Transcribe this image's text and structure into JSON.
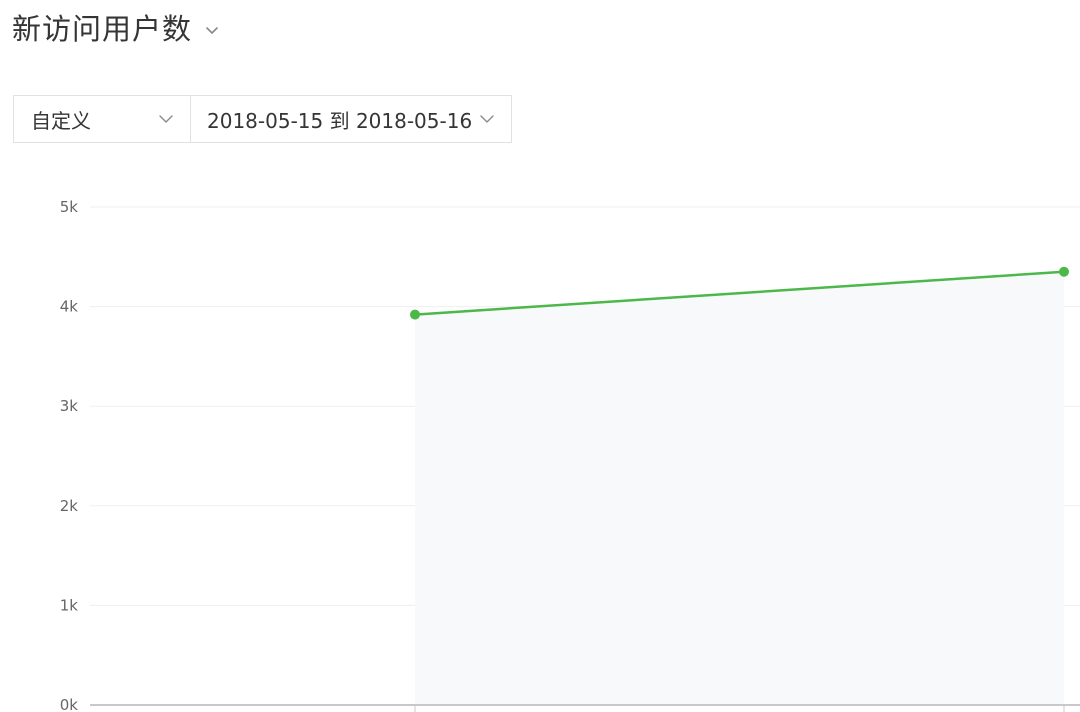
{
  "header": {
    "title": "新访问用户数"
  },
  "controls": {
    "range_type": "自定义",
    "date_range": "2018-05-15 到 2018-05-16"
  },
  "icons": {
    "title_chevron": "chevron-down-icon",
    "dropdown_chevron": "chevron-down-icon"
  },
  "colors": {
    "line": "#4cb849",
    "area": "#f7f9fb",
    "grid": "#efefef",
    "axis": "#c8c8c8"
  },
  "chart_data": {
    "type": "area",
    "title": "",
    "xlabel": "",
    "ylabel": "",
    "x": [
      "2018-05-15",
      "2018-05-16"
    ],
    "series": [
      {
        "values": [
          3920,
          4350
        ]
      }
    ],
    "ylim": [
      0,
      5000
    ],
    "yticks": [
      0,
      1000,
      2000,
      3000,
      4000,
      5000
    ],
    "ytick_labels": [
      "0k",
      "1k",
      "2k",
      "3k",
      "4k",
      "5k"
    ],
    "grid": true,
    "legend": "none"
  }
}
